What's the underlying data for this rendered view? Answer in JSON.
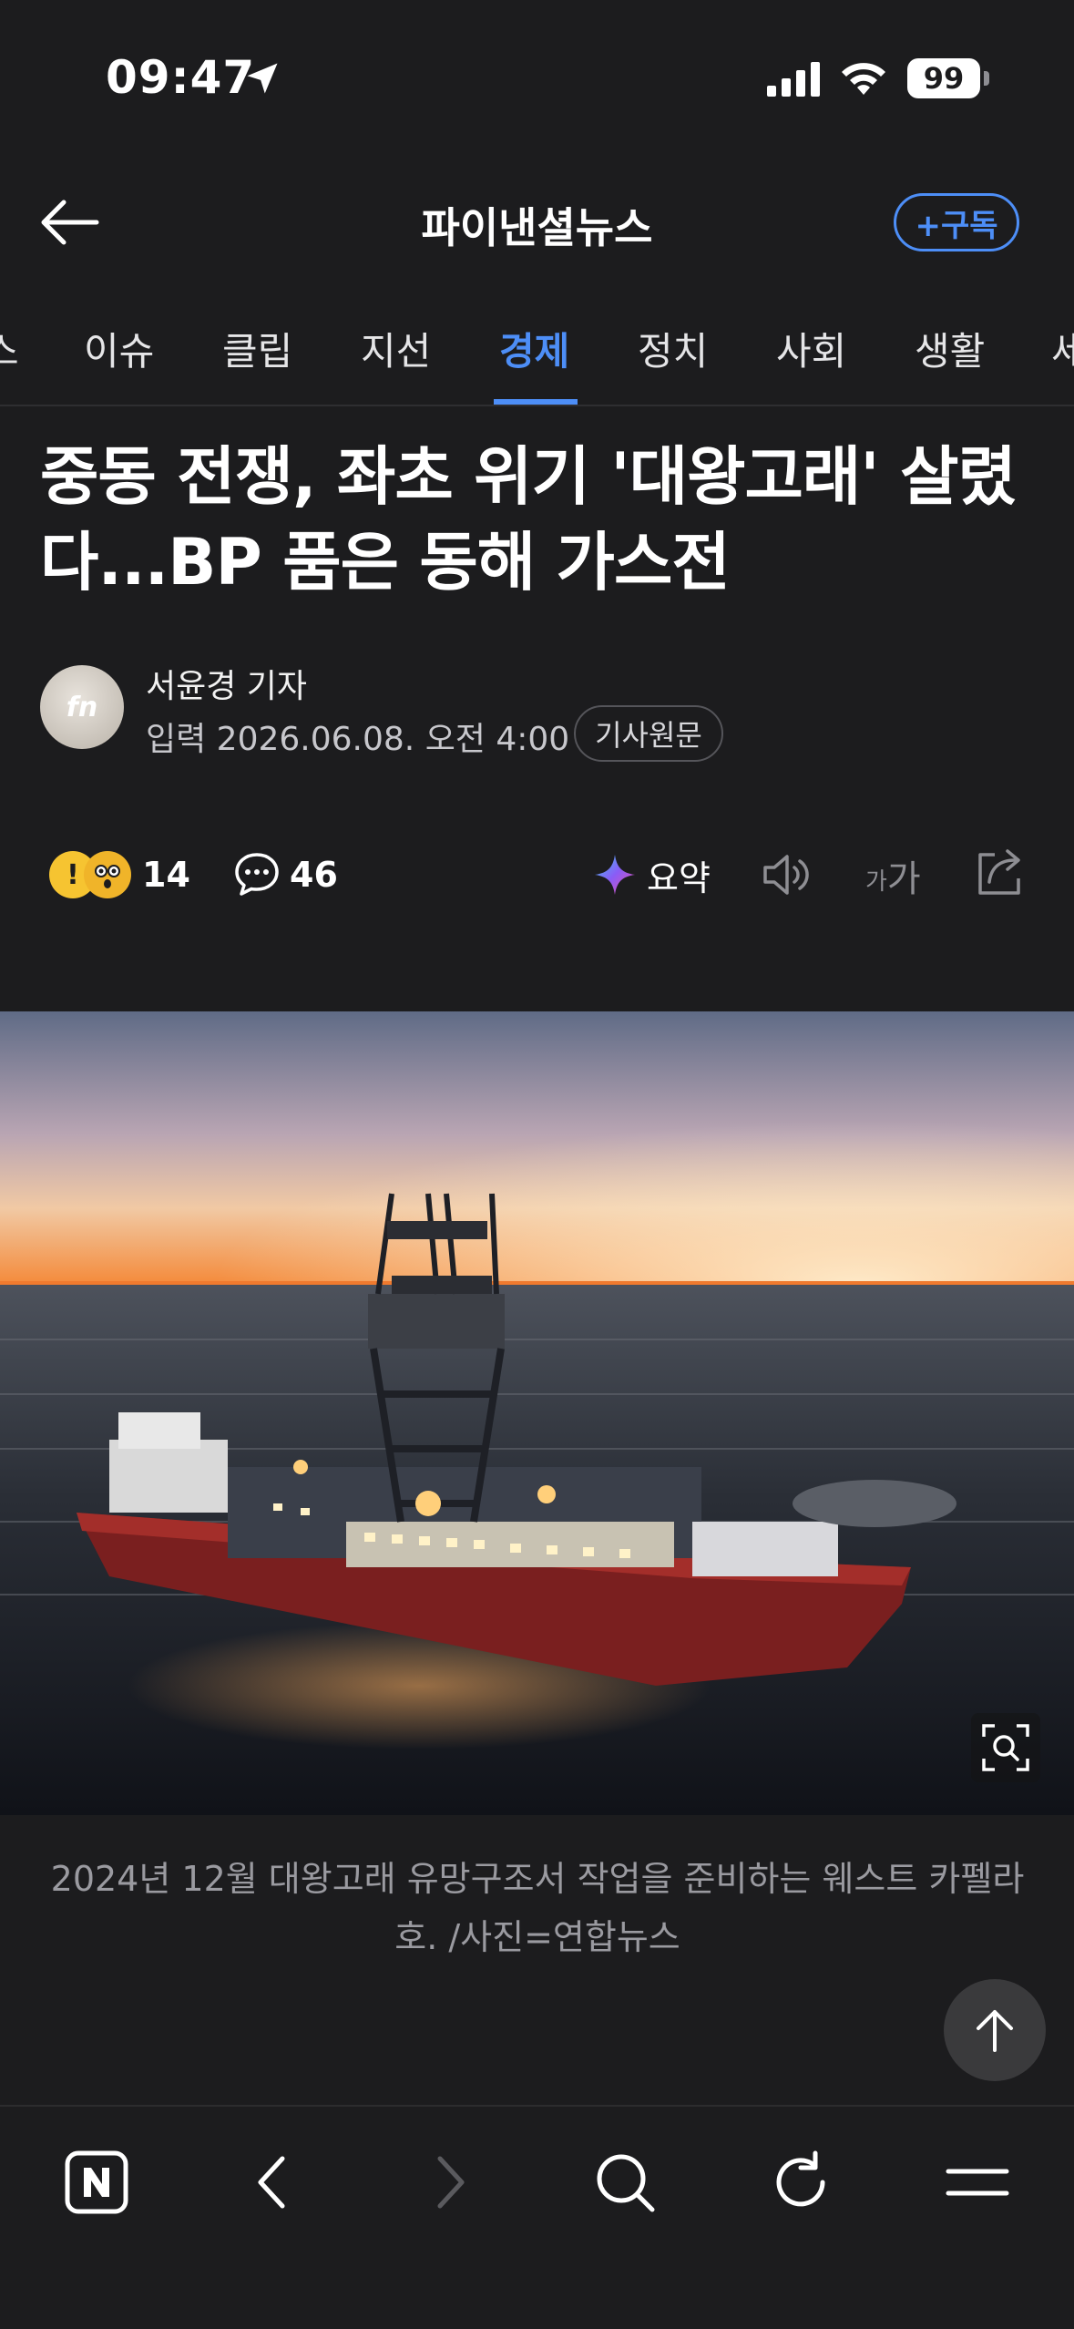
{
  "status_bar": {
    "time": "09:47",
    "battery": "99"
  },
  "header": {
    "title": "파이낸셜뉴스",
    "subscribe_label": "+구독"
  },
  "tabs": [
    {
      "label": "스"
    },
    {
      "label": "이슈"
    },
    {
      "label": "클립"
    },
    {
      "label": "지선"
    },
    {
      "label": "경제",
      "active": true
    },
    {
      "label": "정치"
    },
    {
      "label": "사회"
    },
    {
      "label": "생활"
    },
    {
      "label": "세"
    }
  ],
  "article": {
    "headline": "중동 전쟁, 좌초 위기 '대왕고래' 살렸다...BP 품은 동해 가스전",
    "author_logo": "fn",
    "author": "서윤경 기자",
    "date": "입력 2026.06.08. 오전 4:00",
    "source_label": "기사원문"
  },
  "actions": {
    "reaction_count": "14",
    "comment_count": "46",
    "summary_label": "요약",
    "font_small": "가",
    "font_big": "가"
  },
  "photo": {
    "caption": "2024년 12월 대왕고래 유망구조서 작업을 준비하는 웨스트 카펠라호. /사진=연합뉴스"
  },
  "colors": {
    "background": "#1c1c1e",
    "accent": "#4d8ef7",
    "muted_text": "#9a9aa0"
  },
  "icons": [
    "location-arrow-icon",
    "cellular-signal-icon",
    "wifi-icon",
    "battery-icon",
    "back-arrow-icon",
    "reaction-emoji-icon",
    "comment-icon",
    "ai-summary-icon",
    "speaker-icon",
    "font-size-icon",
    "share-icon",
    "zoom-icon",
    "arrow-up-icon",
    "naver-home-icon",
    "chevron-left-icon",
    "chevron-right-icon",
    "search-icon",
    "reload-icon",
    "menu-icon"
  ]
}
